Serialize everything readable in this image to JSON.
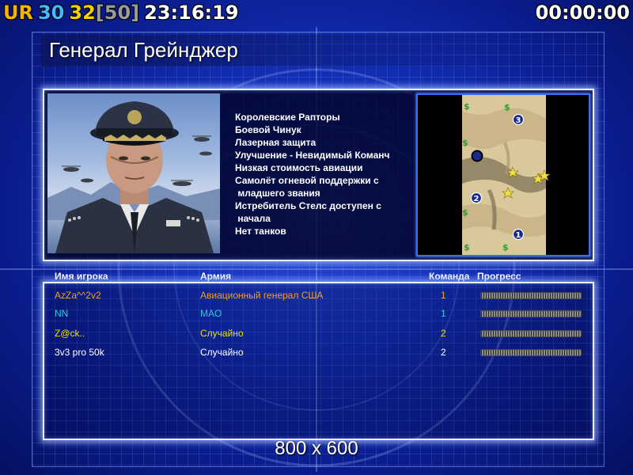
{
  "hud": {
    "ur_label": "UR",
    "fps": "30",
    "current": "32",
    "max": "[50]",
    "clock": "23:16:19",
    "timer": "00:00:00"
  },
  "general": {
    "name": "Генерал Грейнджер",
    "perks": [
      "Королевские Рапторы",
      "Боевой Чинук",
      "Лазерная защита",
      "Улучшение - Невидимый Команч",
      "Низкая стоимость авиации",
      "Самолёт огневой поддержки с",
      " младшего звания",
      "Истребитель Стелс доступен с",
      " начала",
      "Нет танков"
    ]
  },
  "minimap": {
    "markers": [
      {
        "type": "start",
        "label": "3"
      },
      {
        "type": "start",
        "label": "2"
      },
      {
        "type": "start",
        "label": "1"
      }
    ]
  },
  "players": {
    "headers": {
      "name": "Имя игрока",
      "army": "Армия",
      "team": "Команда",
      "progress": "Прогресс"
    },
    "rows": [
      {
        "name": "AzZa^^2v2",
        "army": "Авиационный генерал США",
        "team": "1",
        "color": "#f0a020",
        "progress": 100
      },
      {
        "name": "NN",
        "army": "MAO",
        "team": "1",
        "color": "#35c8dc",
        "progress": 100
      },
      {
        "name": "Z@ck..",
        "army": "Случайно",
        "team": "2",
        "color": "#f0e000",
        "progress": 100
      },
      {
        "name": "3v3 pro 50k",
        "army": "Случайно",
        "team": "2",
        "color": "#ffffff",
        "progress": 100
      }
    ]
  },
  "resolution": "800 x 600"
}
